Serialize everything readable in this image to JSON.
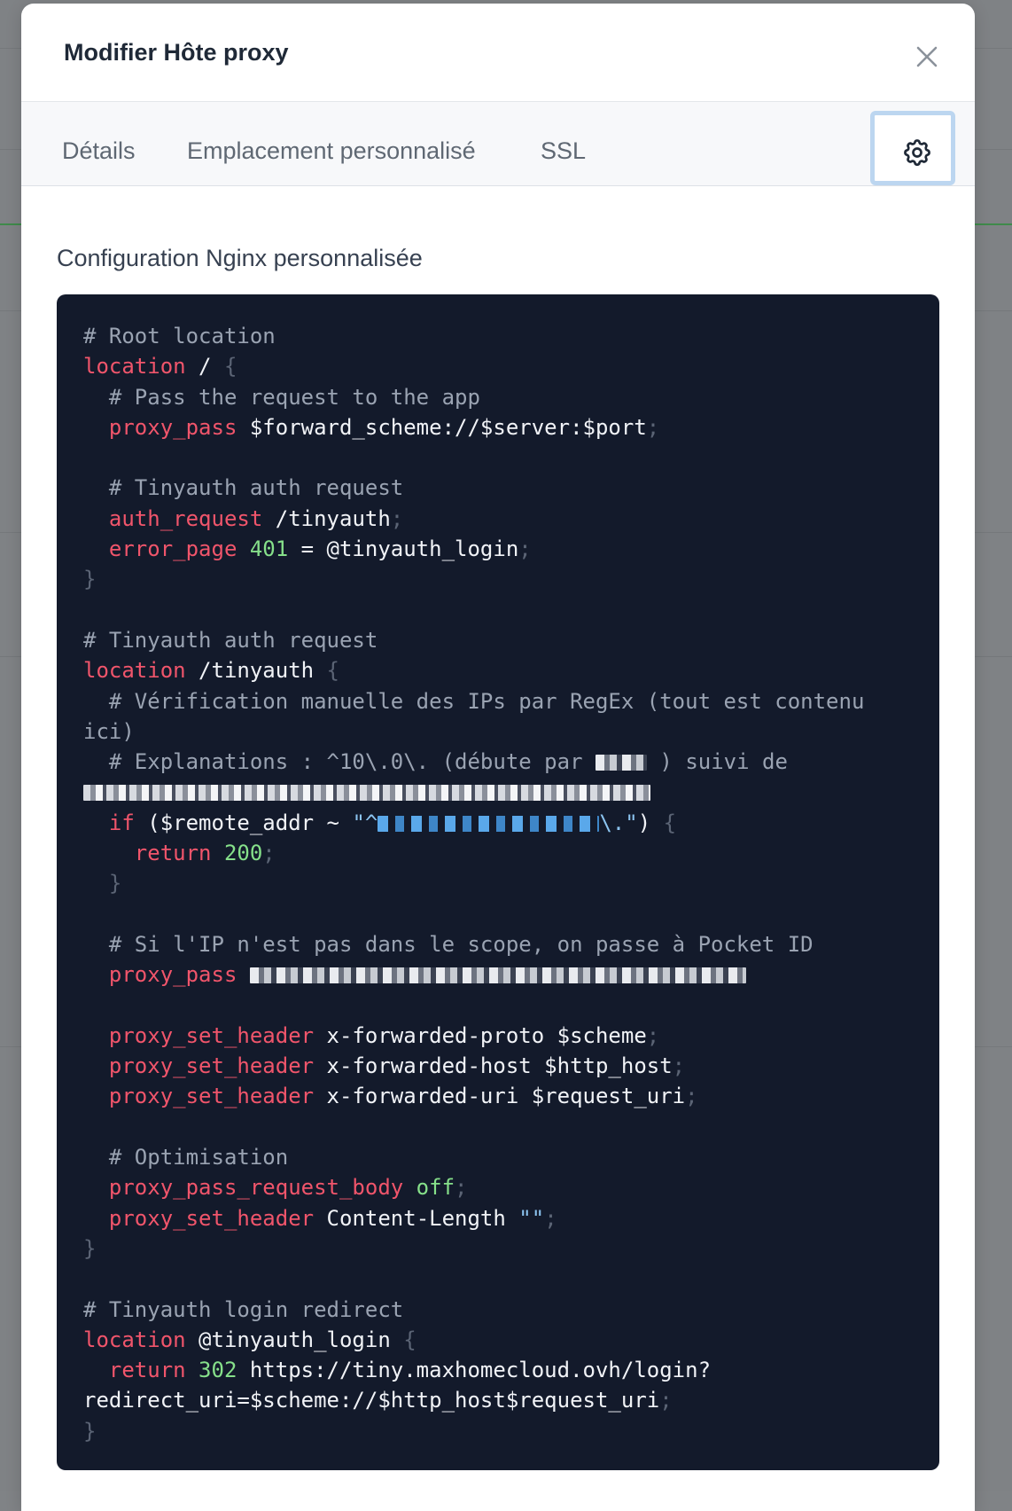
{
  "modal": {
    "title": "Modifier Hôte proxy"
  },
  "tabs": [
    {
      "label": "Détails"
    },
    {
      "label": "Emplacement personnalisé"
    },
    {
      "label": "SSL"
    }
  ],
  "active_tab_icon": "gear-icon",
  "section": {
    "label": "Configuration Nginx personnalisée"
  },
  "code": {
    "l1": "# Root location",
    "l2_kw": "location",
    "l2_path": " / ",
    "l3": "  # Pass the request to the app",
    "l4_kw": "  proxy_pass",
    "l4_val": " $forward_scheme://$server:$port",
    "l6": "  # Tinyauth auth request",
    "l7_kw": "  auth_request",
    "l7_val": " /tinyauth",
    "l8_kw": "  error_page",
    "l8_num": " 401",
    "l8_val": " = @tinyauth_login",
    "l10": "# Tinyauth auth request",
    "l11_kw": "location",
    "l11_path": " /tinyauth ",
    "l12": "  # Vérification manuelle des IPs par RegEx (tout est contenu",
    "l13": "ici)",
    "l14a": "  # Explanations : ^10\\.0\\. (débute par ",
    "l14b": " ) suivi de",
    "l16_kw": "  if",
    "l16_val": " ($remote_addr ~ ",
    "l16_str_a": "\"^",
    "l16_str_b": "\\.\"",
    "l16_end": ") ",
    "l17_kw": "    return",
    "l17_num": " 200",
    "l20": "  # Si l'IP n'est pas dans le scope, on passe à Pocket ID",
    "l21_kw": "  proxy_pass",
    "l23_kw": "  proxy_set_header",
    "l23_val": " x-forwarded-proto $scheme",
    "l24_kw": "  proxy_set_header",
    "l24_val": " x-forwarded-host $http_host",
    "l25_kw": "  proxy_set_header",
    "l25_val": " x-forwarded-uri $request_uri",
    "l27": "  # Optimisation",
    "l28_kw": "  proxy_pass_request_body",
    "l28_num": " off",
    "l29_kw": "  proxy_set_header",
    "l29_val": " Content-Length ",
    "l29_str": "\"\"",
    "l32": "# Tinyauth login redirect",
    "l33_kw": "location",
    "l33_val": " @tinyauth_login ",
    "l34_kw": "  return",
    "l34_num": " 302",
    "l34_val": " https://tiny.maxhomecloud.ovh/login?",
    "l35": "redirect_uri=$scheme://$http_host$request_uri",
    "brace_open": "{",
    "brace_close": "}",
    "semicolon": ";",
    "indent2": "  ",
    "indent1": " "
  }
}
